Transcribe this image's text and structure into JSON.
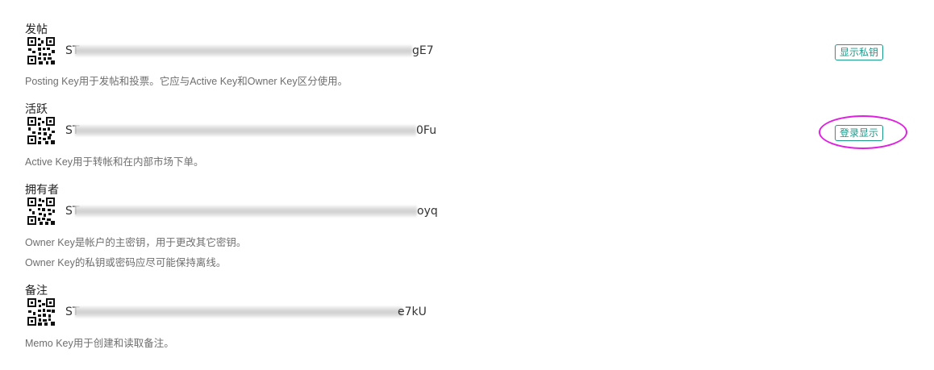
{
  "keys": {
    "posting": {
      "title": "发帖",
      "prefix": "ST",
      "suffix": "gE7",
      "desc": "Posting Key用于发帖和投票。它应与Active Key和Owner Key区分使用。",
      "button_label": "显示私钥"
    },
    "active": {
      "title": "活跃",
      "prefix": "ST",
      "suffix": "0Fu",
      "desc": "Active Key用于转帐和在内部市场下单。",
      "button_label": "登录显示"
    },
    "owner": {
      "title": "拥有者",
      "prefix": "ST",
      "suffix": "oyq",
      "desc1": "Owner Key是帐户的主密钥，用于更改其它密钥。",
      "desc2": "Owner Key的私钥或密码应尽可能保持离线。"
    },
    "memo": {
      "title": "备注",
      "prefix": "ST",
      "suffix": "e7kU",
      "desc": "Memo Key用于创建和读取备注。"
    }
  },
  "colors": {
    "accent": "#1a9b8c",
    "highlight": "#e020e0"
  },
  "icons": {
    "qr": "qr-code-icon"
  }
}
